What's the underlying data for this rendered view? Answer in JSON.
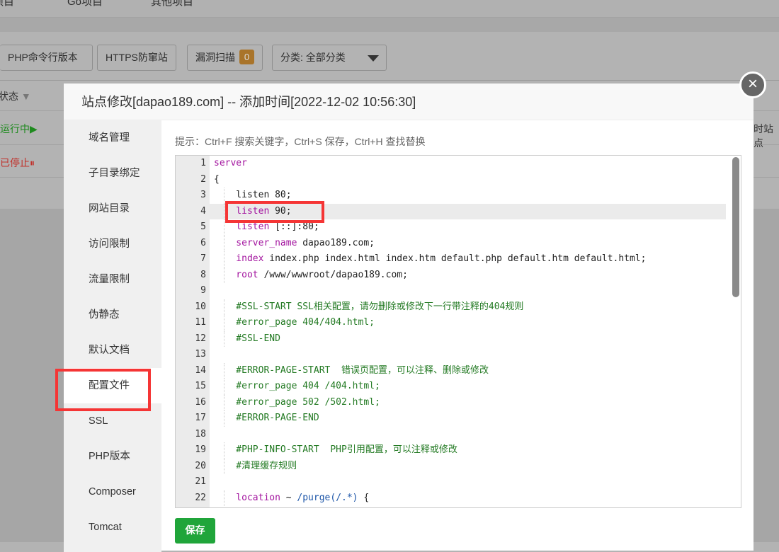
{
  "top_nav": [
    "项目",
    "Go项目",
    "其他项目"
  ],
  "toolbar": {
    "php_cli": "PHP命令行版本",
    "https": "HTTPS防窜站",
    "vuln_scan": "漏洞扫描",
    "vuln_count": "0",
    "category": "分类: 全部分类"
  },
  "table": {
    "status_header": "状态",
    "rows": [
      {
        "status": "运行中▶",
        "color": "#1e8a1e"
      },
      {
        "status": "已停止⏸",
        "color": "#c0302a"
      }
    ],
    "right_text": "时站点"
  },
  "modal": {
    "title": "站点修改[dapao189.com] -- 添加时间[2022-12-02 10:56:30]",
    "close_icon": "close-icon",
    "sidebar": [
      "域名管理",
      "子目录绑定",
      "网站目录",
      "访问限制",
      "流量限制",
      "伪静态",
      "默认文档",
      "配置文件",
      "SSL",
      "PHP版本",
      "Composer",
      "Tomcat"
    ],
    "active_item": "配置文件",
    "hint": "提示：Ctrl+F 搜索关键字，Ctrl+S 保存，Ctrl+H 查找替换",
    "save_label": "保存",
    "code_lines": [
      [
        [
          "kw",
          "server"
        ]
      ],
      [
        [
          "tx",
          "{"
        ]
      ],
      [
        [
          "tx",
          "    listen 80;"
        ]
      ],
      [
        [
          "kw",
          "    listen"
        ],
        [
          "tx",
          " 90;"
        ]
      ],
      [
        [
          "kw",
          "    listen"
        ],
        [
          "tx",
          " [::]:80;"
        ]
      ],
      [
        [
          "kw",
          "    server_name"
        ],
        [
          "tx",
          " dapao189.com;"
        ]
      ],
      [
        [
          "kw",
          "    index"
        ],
        [
          "tx",
          " index.php index.html index.htm default.php default.htm default.html;"
        ]
      ],
      [
        [
          "kw",
          "    root"
        ],
        [
          "tx",
          " /www/wwwroot/dapao189.com;"
        ]
      ],
      [
        [
          "tx",
          ""
        ]
      ],
      [
        [
          "cm",
          "    #SSL-START SSL相关配置，请勿删除或修改下一行带注释的404规则"
        ]
      ],
      [
        [
          "cm",
          "    #error_page 404/404.html;"
        ]
      ],
      [
        [
          "cm",
          "    #SSL-END"
        ]
      ],
      [
        [
          "tx",
          ""
        ]
      ],
      [
        [
          "cm",
          "    #ERROR-PAGE-START  错误页配置，可以注释、删除或修改"
        ]
      ],
      [
        [
          "cm",
          "    #error_page 404 /404.html;"
        ]
      ],
      [
        [
          "cm",
          "    #error_page 502 /502.html;"
        ]
      ],
      [
        [
          "cm",
          "    #ERROR-PAGE-END"
        ]
      ],
      [
        [
          "tx",
          ""
        ]
      ],
      [
        [
          "cm",
          "    #PHP-INFO-START  PHP引用配置，可以注释或修改"
        ]
      ],
      [
        [
          "cm",
          "    #清理缓存规则"
        ]
      ],
      [
        [
          "tx",
          ""
        ]
      ],
      [
        [
          "kw",
          "    location"
        ],
        [
          "tx",
          " ~ "
        ],
        [
          "pa",
          "/purge(/.*)"
        ],
        [
          "tx",
          " {"
        ]
      ]
    ],
    "current_line": 4
  },
  "colors": {
    "accent_green": "#20a53a",
    "highlight_red": "#f53535"
  }
}
